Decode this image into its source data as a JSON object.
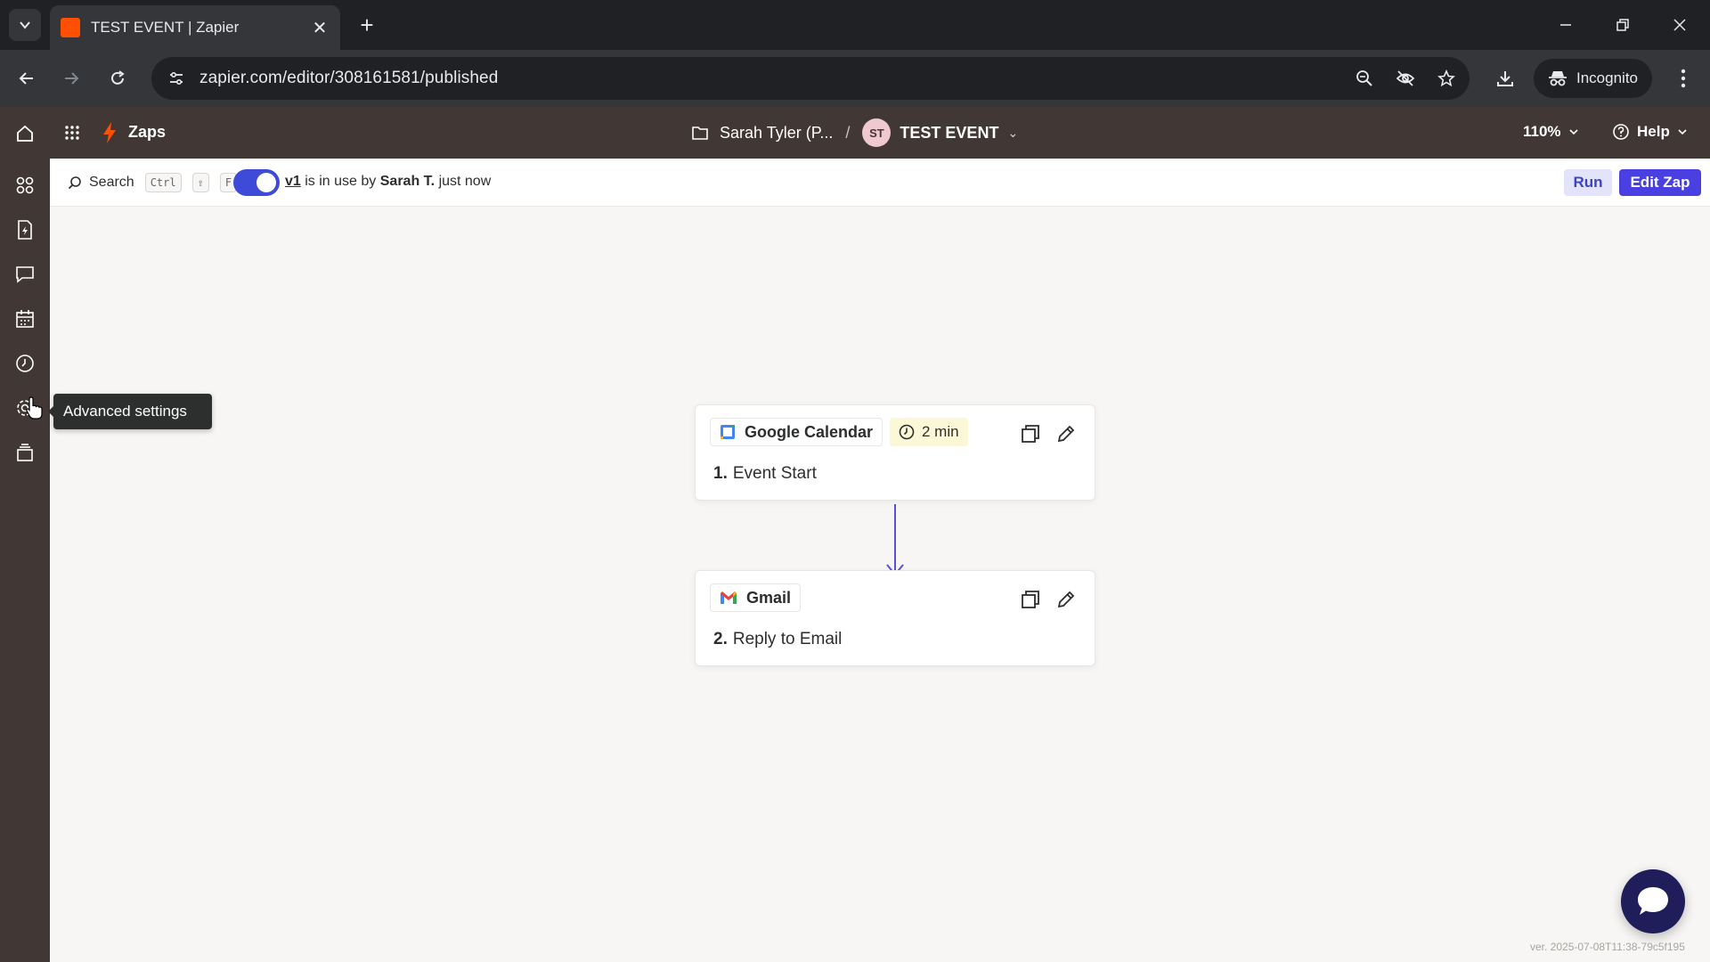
{
  "browser": {
    "tab_title": "TEST EVENT | Zapier",
    "url": "zapier.com/editor/308161581/published",
    "incognito_label": "Incognito",
    "icons": [
      "tab-search-icon",
      "close-icon",
      "plus-icon",
      "minimize-icon",
      "restore-icon",
      "close-window-icon",
      "back-icon",
      "forward-icon",
      "reload-icon",
      "site-settings-icon",
      "zoom-icon",
      "eye-off-icon",
      "star-icon",
      "download-icon",
      "incognito-icon",
      "kebab-menu-icon"
    ]
  },
  "appbar": {
    "product_label": "Zaps",
    "folder_name": "Sarah Tyler (P...",
    "separator": "/",
    "avatar_initials": "ST",
    "zap_name": "TEST EVENT",
    "zoom": "110%",
    "help_label": "Help"
  },
  "rail": {
    "items": [
      "home",
      "apps",
      "zaps",
      "tables",
      "interfaces",
      "canvas",
      "history",
      "advanced-settings",
      "versions"
    ]
  },
  "subbar": {
    "search_label": "Search",
    "shortcut_keys": [
      "Ctrl",
      "⇧",
      "F"
    ],
    "version_link": "v1",
    "status_text_1": "is in use by",
    "status_user": "Sarah T.",
    "status_time": "just now",
    "run_label": "Run",
    "edit_label": "Edit Zap",
    "toggle_on": true
  },
  "tooltip": {
    "text": "Advanced settings"
  },
  "steps": [
    {
      "app": "Google Calendar",
      "time": "2 min",
      "number": "1.",
      "title": "Event Start"
    },
    {
      "app": "Gmail",
      "number": "2.",
      "title": "Reply to Email"
    }
  ],
  "colors": {
    "brand_dark": "#413735",
    "accent": "#4a3fe0",
    "zapier_orange": "#ff4f00"
  },
  "version_text": "ver. 2025-07-08T11:38-79c5f195"
}
